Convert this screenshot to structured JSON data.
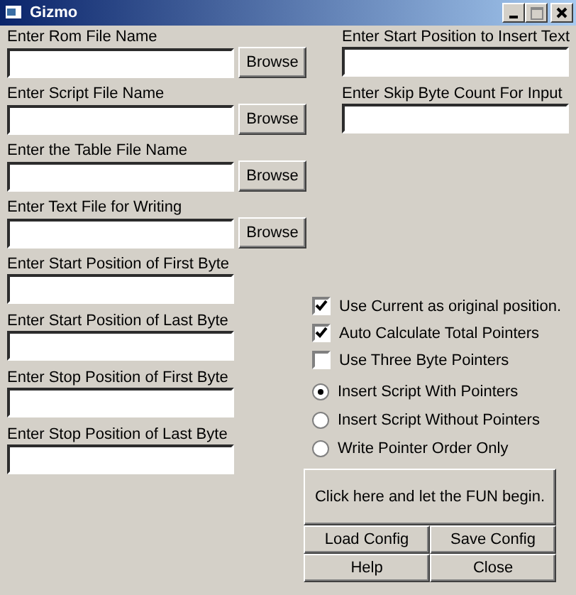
{
  "window": {
    "title": "Gizmo"
  },
  "left_fields": [
    {
      "label": "Enter Rom File Name",
      "browse": "Browse"
    },
    {
      "label": "Enter Script File Name",
      "browse": "Browse"
    },
    {
      "label": "Enter the Table File Name",
      "browse": "Browse"
    },
    {
      "label": "Enter Text File for Writing",
      "browse": "Browse"
    },
    {
      "label": "Enter Start Position of First Byte"
    },
    {
      "label": "Enter Start Position of Last Byte"
    },
    {
      "label": "Enter Stop Position of First Byte"
    },
    {
      "label": "Enter Stop Position of Last Byte"
    }
  ],
  "right_fields": [
    {
      "label": "Enter Start Position to Insert Text"
    },
    {
      "label": "Enter Skip Byte Count For Input"
    }
  ],
  "options": [
    {
      "kind": "checkbox",
      "label": "Use Current as original position.",
      "checked": true
    },
    {
      "kind": "checkbox",
      "label": "Auto Calculate Total Pointers",
      "checked": true
    },
    {
      "kind": "checkbox",
      "label": "Use Three Byte Pointers",
      "checked": false
    },
    {
      "kind": "radio",
      "label": "Insert Script With Pointers",
      "selected": true
    },
    {
      "kind": "radio",
      "label": "Insert Script Without Pointers",
      "selected": false
    },
    {
      "kind": "radio",
      "label": "Write Pointer Order Only",
      "selected": false
    }
  ],
  "run_button": "Click here and let the FUN begin.",
  "buttons": [
    "Load Config",
    "Save Config",
    "Help",
    "Close"
  ]
}
